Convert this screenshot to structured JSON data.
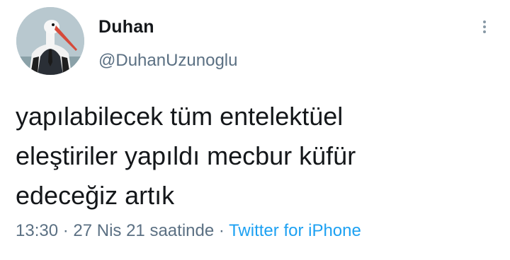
{
  "user": {
    "display_name": "Duhan",
    "handle": "@DuhanUzunoglu",
    "avatar_icon": "stork-in-suit-avatar"
  },
  "tweet": {
    "lines": [
      "yapılabilecek tüm entelektüel",
      "eleştiriler yapıldı mecbur küfür",
      "edeceğiz artık"
    ]
  },
  "meta": {
    "time": "13:30",
    "separator": " · ",
    "date": "27 Nis 21 saatinde",
    "source": "Twitter for iPhone"
  },
  "icons": {
    "more": "vertical-ellipsis-icon"
  },
  "colors": {
    "text": "#14171a",
    "secondary": "#5b7083",
    "link": "#1da1f2"
  }
}
